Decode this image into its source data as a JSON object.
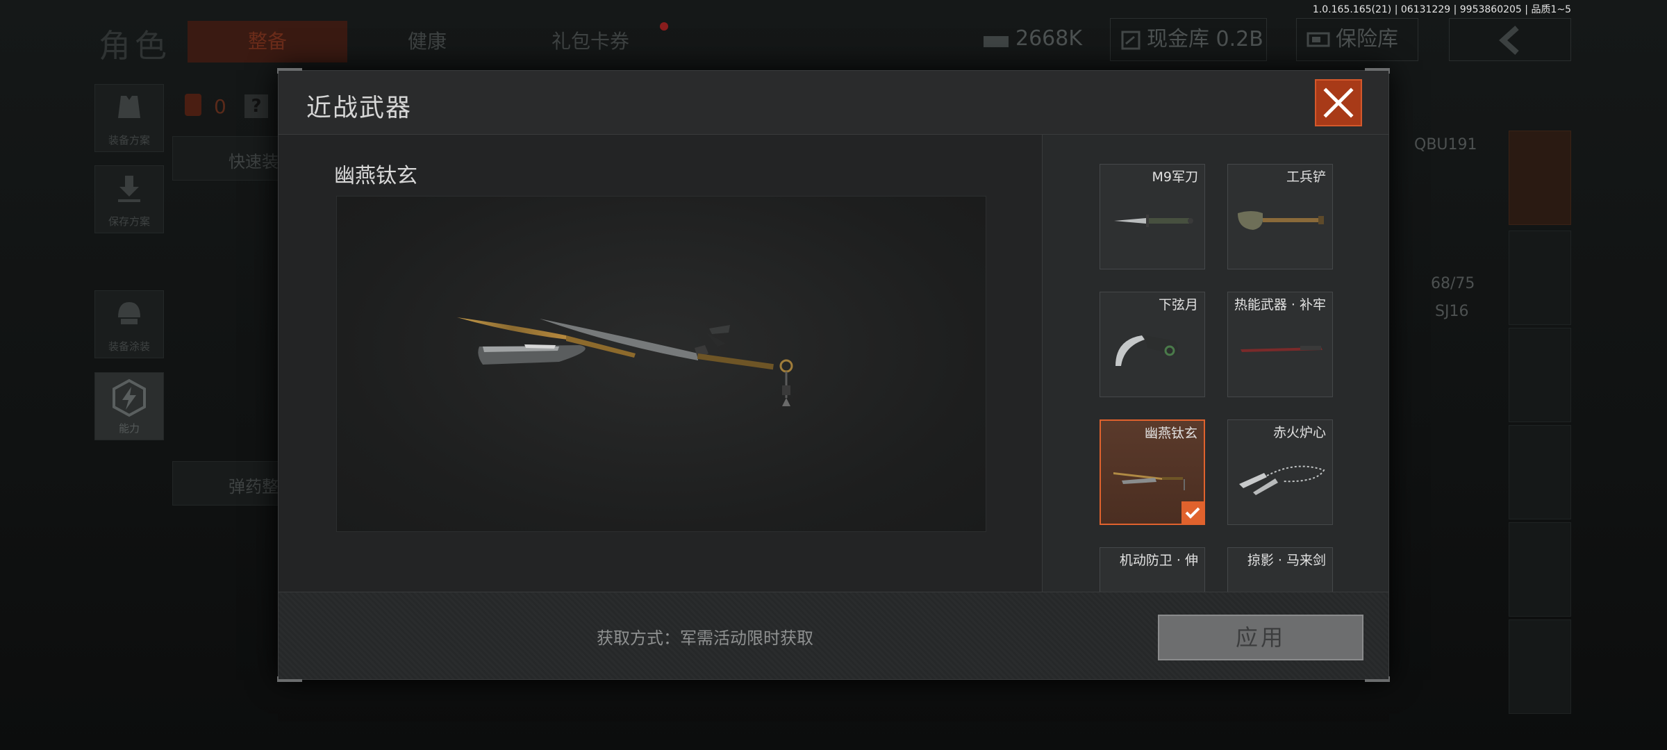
{
  "version_info": "1.0.165.165(21) | 06131229 | 9953860205 | 品质1~5",
  "background": {
    "section_title": "角色",
    "tabs": [
      {
        "label": "整备",
        "active": true
      },
      {
        "label": "健康",
        "active": false
      },
      {
        "label": "礼包卡券",
        "active": false
      }
    ],
    "currency": {
      "icon": "cash-stack-icon",
      "value": "2668K"
    },
    "vault": {
      "icon": "vault-icon",
      "label": "现金库 0.2B"
    },
    "safe": {
      "icon": "safe-icon",
      "label": "保险库"
    },
    "back_icon": "chevron-left-icon",
    "counter": "0",
    "help_icon": "question-icon",
    "left_menu": [
      {
        "label": "装备方案",
        "icon": "vest-icon"
      },
      {
        "label": "保存方案",
        "icon": "download-icon"
      },
      {
        "label": "装备涂装",
        "icon": "helmet-icon"
      },
      {
        "label": "能力",
        "icon": "energy-icon",
        "active": true
      }
    ],
    "quick_equip": "快速装",
    "ammo_sort": "弹药整",
    "weapon_code": "QBU191",
    "ammo_count": "68/75",
    "secondary_code": "SJ16"
  },
  "modal": {
    "title": "近战武器",
    "close_icon": "close-icon",
    "preview_name": "幽燕钛玄",
    "items": [
      {
        "name": "M9军刀",
        "icon": "combat-knife-icon",
        "selected": false
      },
      {
        "name": "工兵铲",
        "icon": "shovel-icon",
        "selected": false
      },
      {
        "name": "下弦月",
        "icon": "karambit-icon",
        "selected": false
      },
      {
        "name": "热能武器 · 补牢",
        "icon": "thermal-blade-icon",
        "selected": false
      },
      {
        "name": "幽燕钛玄",
        "icon": "twin-blade-icon",
        "selected": true
      },
      {
        "name": "赤火炉心",
        "icon": "chain-blade-icon",
        "selected": false
      },
      {
        "name": "机动防卫 · 伸",
        "icon": "baton-icon",
        "selected": false
      },
      {
        "name": "掠影 · 马来剑",
        "icon": "kris-icon",
        "selected": false
      }
    ],
    "acquire_text": "获取方式：军需活动限时获取",
    "apply_label": "应用"
  },
  "colors": {
    "accent": "#e0622d",
    "close_bg": "#a83a18",
    "modal_bg": "#232425"
  }
}
